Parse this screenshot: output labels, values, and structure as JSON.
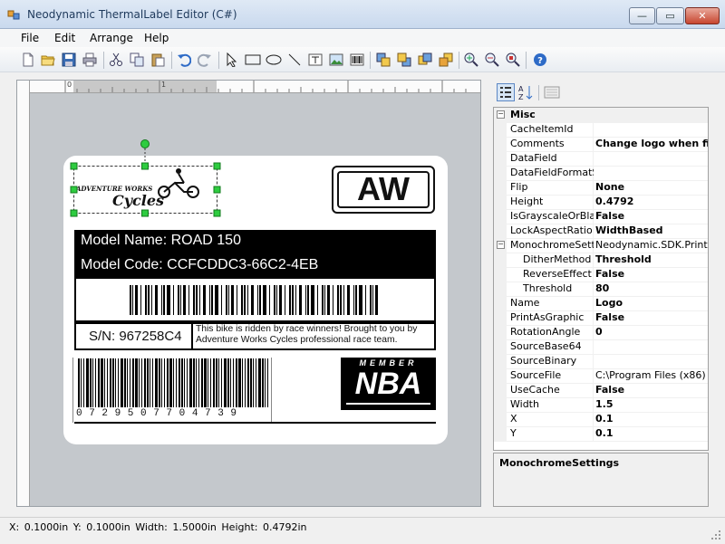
{
  "window": {
    "title": "Neodynamic ThermalLabel Editor (C#)",
    "minimize": "—",
    "maximize": "▭",
    "close": "✕"
  },
  "menu": [
    "File",
    "Edit",
    "Arrange",
    "Help"
  ],
  "toolbar_icons": [
    "new-icon",
    "open-icon",
    "save-icon",
    "print-icon",
    "cut-icon",
    "copy-icon",
    "paste-icon",
    "undo-icon",
    "redo-icon",
    "pointer-icon",
    "rectangle-tool-icon",
    "ellipse-tool-icon",
    "line-tool-icon",
    "text-tool-icon",
    "image-tool-icon",
    "barcode-tool-icon",
    "bring-front-icon",
    "send-back-icon",
    "bring-forward-icon",
    "send-backward-icon",
    "zoom-in-icon",
    "zoom-out-icon",
    "zoom-fit-icon",
    "help-icon"
  ],
  "ruler": {
    "top": [
      "0",
      "1"
    ]
  },
  "label": {
    "logo_line1": "ADVENTURE WORKS",
    "logo_line2": "Cycles",
    "aw": "AW",
    "model_name": "Model Name: ROAD 150",
    "model_code": "Model Code: CCFCDDC3-66C2-4EB",
    "serial": "S/N: 967258C4",
    "note": "This bike is ridden by race winners! Brought to you by Adventure Works Cycles professional race team.",
    "upc_digits": "0 7 2 9 5 0 7 7 0 4 7 3 9",
    "nba_top": "MEMBER",
    "nba": "NBA"
  },
  "propgrid": {
    "category": "Misc",
    "rows": [
      {
        "name": "CacheItemId",
        "value": ""
      },
      {
        "name": "Comments",
        "value": "Change logo when fina"
      },
      {
        "name": "DataField",
        "value": ""
      },
      {
        "name": "DataFieldFormatStr",
        "value": ""
      },
      {
        "name": "Flip",
        "value": "None"
      },
      {
        "name": "Height",
        "value": "0.4792"
      },
      {
        "name": "IsGrayscaleOrBlack",
        "value": "False"
      },
      {
        "name": "LockAspectRatio",
        "value": "WidthBased"
      },
      {
        "name": "MonochromeSettin",
        "value": "Neodynamic.SDK.Printing."
      },
      {
        "name": "DitherMethod",
        "value": "Threshold"
      },
      {
        "name": "ReverseEffect",
        "value": "False"
      },
      {
        "name": "Threshold",
        "value": "80"
      },
      {
        "name": "Name",
        "value": "Logo"
      },
      {
        "name": "PrintAsGraphic",
        "value": "False"
      },
      {
        "name": "RotationAngle",
        "value": "0"
      },
      {
        "name": "SourceBase64",
        "value": ""
      },
      {
        "name": "SourceBinary",
        "value": ""
      },
      {
        "name": "SourceFile",
        "value": "C:\\Program Files (x86)"
      },
      {
        "name": "UseCache",
        "value": "False"
      },
      {
        "name": "Width",
        "value": "1.5"
      },
      {
        "name": "X",
        "value": "0.1"
      },
      {
        "name": "Y",
        "value": "0.1"
      }
    ],
    "description_title": "MonochromeSettings"
  },
  "status": "X: 0.1000in  Y: 0.1000in  Width: 1.5000in  Height: 0.4792in"
}
